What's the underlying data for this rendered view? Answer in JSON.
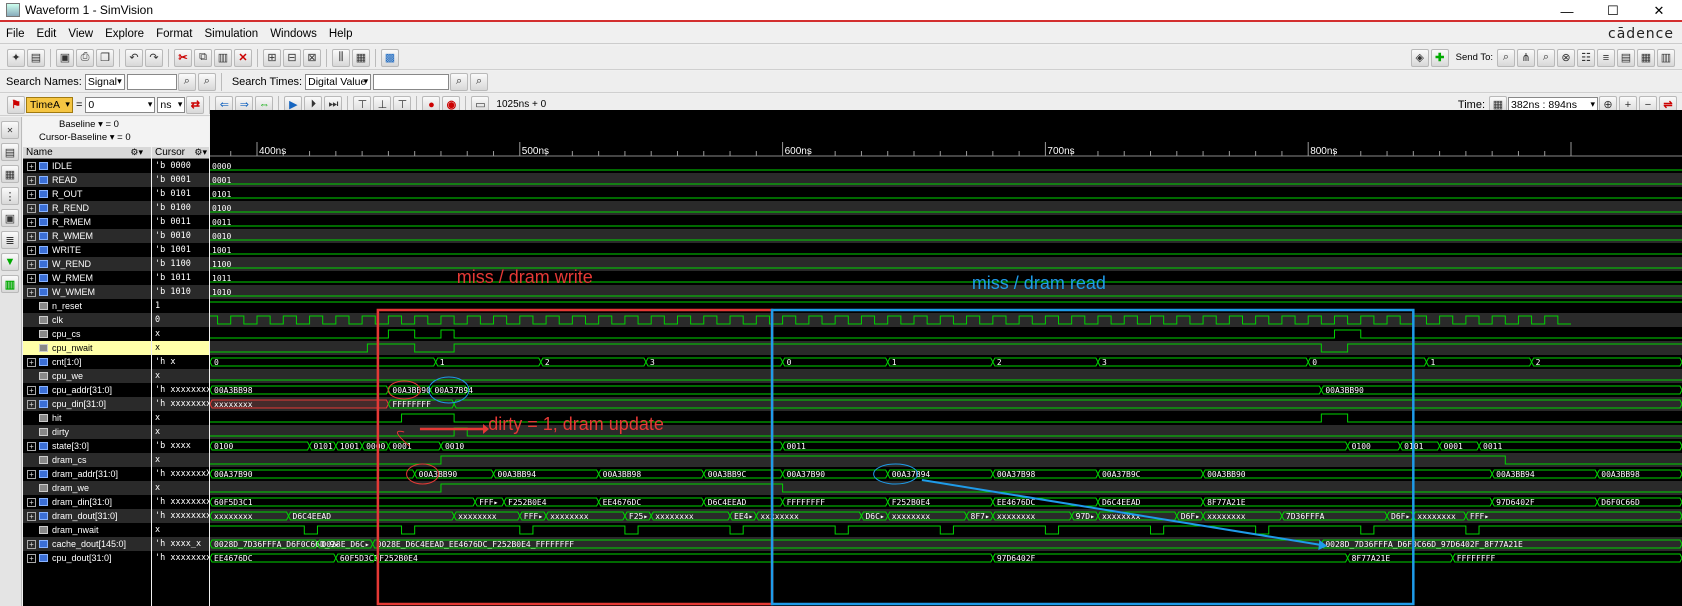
{
  "window": {
    "title": "Waveform 1 - SimVision",
    "min": "—",
    "max": "☐",
    "close": "✕"
  },
  "menu": {
    "items": [
      "File",
      "Edit",
      "View",
      "Explore",
      "Format",
      "Simulation",
      "Windows",
      "Help"
    ],
    "brand": "cādence"
  },
  "toolbar1": {
    "send_to": "Send To:"
  },
  "toolbar2": {
    "search_names_label": "Search Names:",
    "search_names_type": "Signal",
    "search_times_label": "Search Times:",
    "search_times_type": "Digital Value"
  },
  "toolbar3": {
    "time_marker": "TimeA",
    "time_value": "0",
    "time_unit": "ns",
    "sim_time": "1025ns + 0",
    "time_label": "Time:",
    "time_range": "382ns : 894ns"
  },
  "baseline": {
    "baseline": "Baseline ▾ = 0",
    "cursor_baseline": "Cursor-Baseline ▾ = 0"
  },
  "columns": {
    "name": "Name",
    "cursor": "Cursor"
  },
  "ruler": {
    "ticks": [
      "400ns",
      "500ns",
      "600ns",
      "700ns",
      "800ns"
    ]
  },
  "signals": [
    {
      "name": "IDLE",
      "cursor": "'b 0000"
    },
    {
      "name": "READ",
      "cursor": "'b 0001"
    },
    {
      "name": "R_OUT",
      "cursor": "'b 0101"
    },
    {
      "name": "R_REND",
      "cursor": "'b 0100"
    },
    {
      "name": "R_RMEM",
      "cursor": "'b 0011"
    },
    {
      "name": "R_WMEM",
      "cursor": "'b 0010"
    },
    {
      "name": "WRITE",
      "cursor": "'b 1001"
    },
    {
      "name": "W_REND",
      "cursor": "'b 1100"
    },
    {
      "name": "W_RMEM",
      "cursor": "'b 1011"
    },
    {
      "name": "W_WMEM",
      "cursor": "'b 1010"
    },
    {
      "name": "n_reset",
      "cursor": "1"
    },
    {
      "name": "clk",
      "cursor": "0"
    },
    {
      "name": "cpu_cs",
      "cursor": "x"
    },
    {
      "name": "cpu_nwait",
      "cursor": "x"
    },
    {
      "name": "cnt[1:0]",
      "cursor": "'h x"
    },
    {
      "name": "cpu_we",
      "cursor": "x"
    },
    {
      "name": "cpu_addr[31:0]",
      "cursor": "'h xxxxxxxx"
    },
    {
      "name": "cpu_din[31:0]",
      "cursor": "'h xxxxxxxx"
    },
    {
      "name": "hit",
      "cursor": "x"
    },
    {
      "name": "dirty",
      "cursor": "x"
    },
    {
      "name": "state[3:0]",
      "cursor": "'b xxxx"
    },
    {
      "name": "dram_cs",
      "cursor": "x"
    },
    {
      "name": "dram_addr[31:0]",
      "cursor": "'h xxxxxxxX"
    },
    {
      "name": "dram_we",
      "cursor": "x"
    },
    {
      "name": "dram_din[31:0]",
      "cursor": "'h xxxxxxxx"
    },
    {
      "name": "dram_dout[31:0]",
      "cursor": "'h xxxxxxxx"
    },
    {
      "name": "dram_nwait",
      "cursor": "x"
    },
    {
      "name": "cache_dout[145:0]",
      "cursor": "'h xxxx_x"
    },
    {
      "name": "cpu_dout[31:0]",
      "cursor": "'h xxxxxxxx"
    }
  ],
  "wave_labels": {
    "consts": [
      "0000",
      "0001",
      "0101",
      "0100",
      "0011",
      "0010",
      "1001",
      "1100",
      "1011",
      "1010"
    ],
    "n_reset": "1",
    "cnt": [
      "0",
      "1",
      "2",
      "3",
      "0",
      "1",
      "2",
      "3",
      "0",
      "1",
      "2"
    ],
    "cpu_addr": [
      "00A3BB98",
      "00A3BB90",
      "00A37B94",
      "00A3BB90"
    ],
    "cpu_din": [
      "xxxxxxxx",
      "FFFFFFFF"
    ],
    "state": [
      "0100",
      "0101",
      "1001",
      "0000",
      "0001",
      "0010",
      "0011",
      "0100",
      "0101",
      "0001",
      "0011"
    ],
    "dram_addr": [
      "00A37B90",
      "00A3BB90",
      "00A3BB94",
      "00A3BB98",
      "00A3BB9C",
      "00A37B90",
      "00A37B94",
      "00A37B98",
      "00A37B9C",
      "00A3BB90",
      "00A3BB94",
      "00A3BB98"
    ],
    "dram_din": [
      "60F5D3C1",
      "FFF▸",
      "F252B0E4",
      "EE4676DC",
      "D6C4EEAD",
      "FFFFFFFF",
      "F252B0E4",
      "EE4676DC",
      "D6C4EEAD",
      "8F77A21E",
      "97D6402F",
      "D6F0C66D"
    ],
    "dram_dout": [
      "xxxxxxxx",
      "D6C4EEAD",
      "xxxxxxxx",
      "FFF▸",
      "xxxxxxxx",
      "F25▸",
      "xxxxxxxx",
      "EE4▸",
      "xxxxxxxx",
      "D6C▸",
      "xxxxxxxx",
      "8F7▸",
      "xxxxxxxx",
      "97D▸",
      "xxxxxxxx",
      "D6F▸",
      "xxxxxxxx",
      "7D36FFFA",
      "D6F▸",
      "xxxxxxxx",
      "FFF▸"
    ],
    "cache_dout": [
      "0028D_7D36FFFA_D6F0C66D_9▸",
      "0028E_D6C▸",
      "0028E_D6C4EEAD_EE4676DC_F252B0E4_FFFFFFFF",
      "0028D_7D36FFFA_D6F0C66D_97D6402F_8F77A21E"
    ],
    "cpu_dout": [
      "EE4676DC",
      "60F5D3C1",
      "F252B0E4",
      "97D6402F",
      "8F77A21E",
      "FFFFFFFF"
    ]
  },
  "annotations": {
    "miss_write": "miss / dram write",
    "miss_read": "miss / dram read",
    "dirty_note": "dirty = 1, dram update"
  },
  "colors": {
    "wave": "#00d400",
    "x_value": "#e53935",
    "write_box": "#e53935",
    "read_box": "#1e9be9",
    "highlight": "#ffffa8"
  }
}
